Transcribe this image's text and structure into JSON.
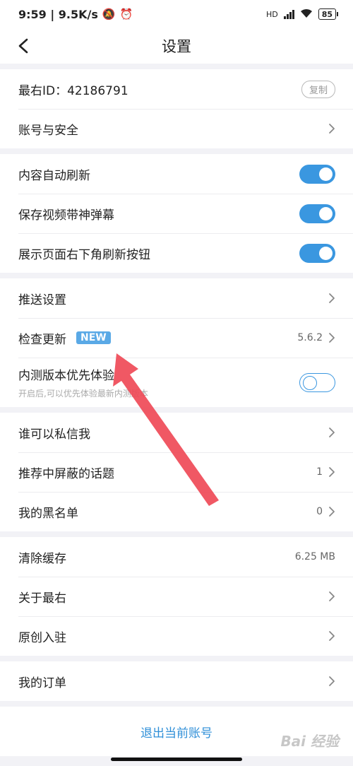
{
  "status_bar": {
    "time_speed": "9:59 | 9.5K/s",
    "battery": "85",
    "network_label": "HD"
  },
  "header": {
    "title": "设置"
  },
  "groups": {
    "account": {
      "id_label": "最右ID：42186791",
      "copy_label": "复制",
      "security_label": "账号与安全"
    },
    "display": {
      "auto_refresh": "内容自动刷新",
      "save_danmaku": "保存视频带神弹幕",
      "show_refresh_button": "展示页面右下角刷新按钮"
    },
    "system": {
      "push_label": "推送设置",
      "update_label": "检查更新",
      "update_badge": "NEW",
      "update_version": "5.6.2",
      "beta_label": "内测版本优先体验",
      "beta_desc": "开启后,可以优先体验最新内测版本"
    },
    "privacy": {
      "dm_label": "谁可以私信我",
      "blocked_topics_label": "推荐中屏蔽的话题",
      "blocked_topics_count": "1",
      "blacklist_label": "我的黑名单",
      "blacklist_count": "0"
    },
    "misc": {
      "clear_cache_label": "清除缓存",
      "cache_size": "6.25 MB",
      "about_label": "关于最右",
      "original_label": "原创入驻"
    },
    "orders": {
      "orders_label": "我的订单"
    }
  },
  "logout": {
    "label": "退出当前账号"
  },
  "watermark": "Bai 经验",
  "toggles": {
    "auto_refresh": true,
    "save_danmaku": true,
    "show_refresh_button": true,
    "beta": false
  },
  "colors": {
    "accent": "#3a97e0",
    "badge": "#5aa9e6",
    "annotation_arrow": "#ef4a57"
  }
}
